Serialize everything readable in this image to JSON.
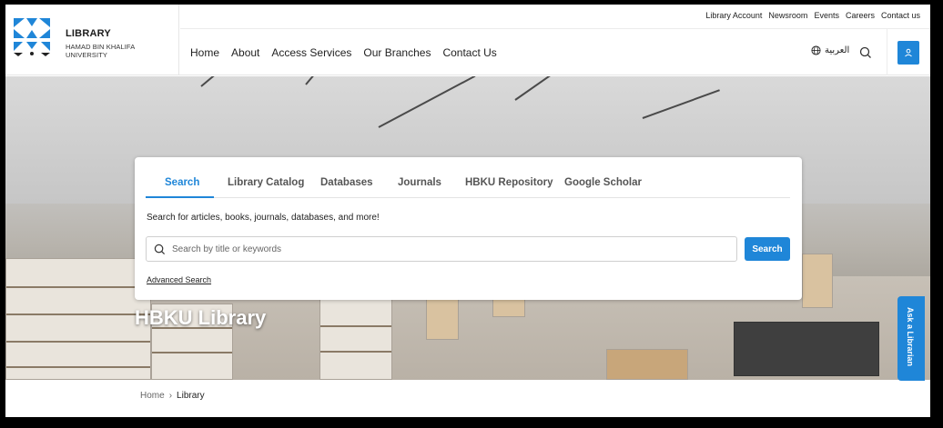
{
  "header": {
    "logo_title": "LIBRARY",
    "logo_subtitle": "HAMAD BIN KHALIFA UNIVERSITY",
    "utility_links": [
      "Library Account",
      "Newsroom",
      "Events",
      "Careers",
      "Contact us"
    ],
    "nav": [
      "Home",
      "About",
      "Access Services",
      "Our Branches",
      "Contact Us"
    ],
    "language_label": "العربية",
    "icons": {
      "language": "globe-icon",
      "search": "search-icon",
      "account": "user-icon"
    },
    "accent_color": "#1f86d8"
  },
  "search_card": {
    "tabs": [
      "Search",
      "Library Catalog",
      "Databases",
      "Journals",
      "HBKU Repository",
      "Google Scholar"
    ],
    "active_tab": "Search",
    "hint": "Search for articles, books, journals, databases, and more!",
    "input_value": "",
    "placeholder": "Search by title or keywords",
    "button_label": "Search",
    "advanced_link": "Advanced Search"
  },
  "hero": {
    "title": "HBKU Library"
  },
  "ask_tab": {
    "label": "Ask a Librarian"
  },
  "breadcrumb": {
    "home": "Home",
    "separator": "›",
    "current": "Library"
  }
}
